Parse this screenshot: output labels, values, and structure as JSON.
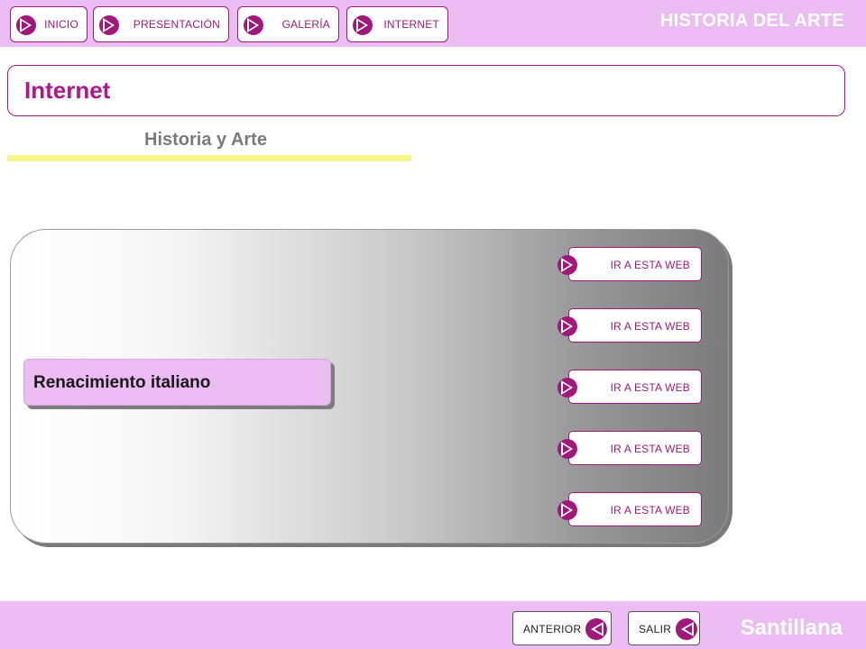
{
  "header": {
    "nav": [
      {
        "label": "INICIO"
      },
      {
        "label": "PRESENTACIÓN"
      },
      {
        "label": "GALERÍA"
      },
      {
        "label": "INTERNET"
      }
    ],
    "brand": "HISTORIA DEL ARTE"
  },
  "section": {
    "title": "Internet",
    "subtitle": "Historia y Arte"
  },
  "panel": {
    "topic": "Renacimiento italiano",
    "links": [
      {
        "label": "IR A ESTA WEB"
      },
      {
        "label": "IR A ESTA WEB"
      },
      {
        "label": "IR A ESTA WEB"
      },
      {
        "label": "IR A ESTA WEB"
      },
      {
        "label": "IR A ESTA WEB"
      }
    ]
  },
  "footer": {
    "prev_label": "ANTERIOR",
    "exit_label": "SALIR",
    "brand": "Santillana"
  },
  "colors": {
    "accent": "#a0197a",
    "bar_background": "#ebbcf2",
    "underline": "#f8f68a"
  }
}
